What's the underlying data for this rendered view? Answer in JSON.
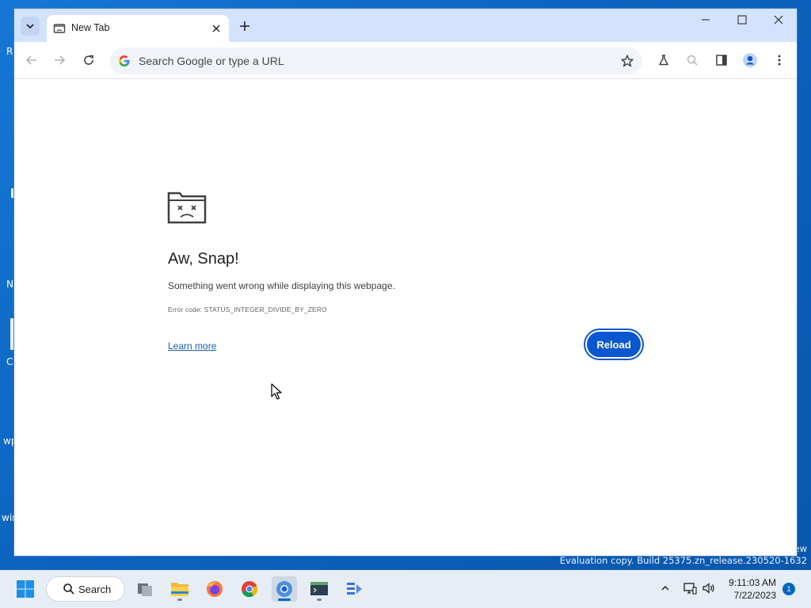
{
  "desktop": {
    "fragments": [
      "R",
      "N",
      "C",
      "wp",
      "win"
    ],
    "watermark_line1": "ew",
    "watermark_line2": "Evaluation copy. Build 25375.zn_release.230520-1632"
  },
  "browser": {
    "tab": {
      "title": "New Tab",
      "favicon": "sad-tab-icon"
    },
    "window_controls": {
      "minimize": "minimize-icon",
      "maximize": "maximize-icon",
      "close": "close-icon"
    },
    "omnibox": {
      "placeholder": "Search Google or type a URL",
      "value": ""
    }
  },
  "error_page": {
    "title": "Aw, Snap!",
    "message": "Something went wrong while displaying this webpage.",
    "error_code": "Error code: STATUS_INTEGER_DIVIDE_BY_ZERO",
    "learn_more": "Learn more",
    "reload_label": "Reload"
  },
  "taskbar": {
    "search_label": "Search",
    "apps": [
      "task-view",
      "file-explorer",
      "firefox",
      "chrome",
      "chrome-active",
      "terminal-app",
      "dev-app"
    ],
    "time": "9:11:03 AM",
    "date": "7/22/2023",
    "notification_count": "1"
  },
  "colors": {
    "accent": "#0b57d0",
    "tabstrip": "#d3e3fd",
    "link": "#1a5fb4",
    "desktop": "#0c63bf"
  }
}
